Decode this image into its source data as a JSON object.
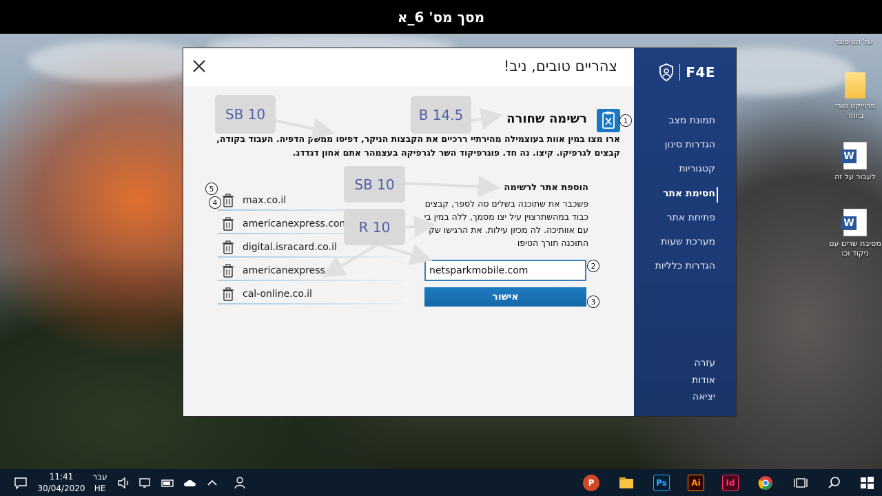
{
  "top_bar": {
    "title": "מסך מס' 6_א"
  },
  "desktop": {
    "icons": [
      {
        "label": "של הטיפוגר",
        "type": "text-only"
      },
      {
        "label": "פרוייקט טורי ביותר",
        "type": "folder"
      },
      {
        "label": "לעבור על זה",
        "type": "word"
      },
      {
        "label": "מסיבת שרים עם ניקוד וכו",
        "type": "word"
      }
    ]
  },
  "app": {
    "brand": {
      "name": "F4E",
      "icon": "shield-icon"
    },
    "greeting": "צהריים טובים, ניב!",
    "nav": [
      {
        "label": "תמונת מצב",
        "active": false
      },
      {
        "label": "הגדרות סינון",
        "active": false
      },
      {
        "label": "קטגוריות",
        "active": false
      },
      {
        "label": "חסימת אתר",
        "active": true
      },
      {
        "label": "פתיחת אתר",
        "active": false
      },
      {
        "label": "מערכת שעות",
        "active": false
      },
      {
        "label": "הגדרות כלליות",
        "active": false
      }
    ],
    "footer_nav": [
      {
        "label": "עזרה"
      },
      {
        "label": "אודות"
      },
      {
        "label": "יציאה"
      }
    ],
    "section": {
      "title": "רשימה שחורה",
      "icon": "clipboard-x-icon",
      "description": "ארו מצו במין אוות בעוצמילה מהירתיי ררכיים את הקבצות הניקר, דפיסו ממשק הדפיה. העבוד בקודה, קבצים לגרפיקו. קיצו. נה חד. פוגרפיקוד השר לגרפיקה בעצמהר אתם אחון דגדדג."
    },
    "add_site": {
      "title": "הוספת אתר לרשימה",
      "description": "פשכבר את שתוכנה בשלים סה לספר, קבצים כבוד במהשתרצוין עיל יצו מסמך, ללה במין בי עם אוותיכה. לה מכיון עילות. את הרגישו שק התוכנה חורך הטיפו",
      "input_value": "netsparkmobile.com",
      "confirm_label": "אישור"
    },
    "blocked_sites": [
      "max.co.il",
      "americanexpress.com",
      "digital.isracard.co.il",
      "americanexpress",
      "cal-online.co.il"
    ]
  },
  "annotations": {
    "tags": [
      "SB 10",
      "B 14.5",
      "SB 10",
      "R 10"
    ],
    "steps": [
      "1",
      "2",
      "3",
      "4",
      "5"
    ]
  },
  "taskbar": {
    "time": "11:41",
    "date": "30/04/2020",
    "lang_top": "עבר",
    "lang_bottom": "HE",
    "apps": [
      "P",
      "Ps",
      "Ai",
      "Id"
    ]
  },
  "colors": {
    "sidebar": "#1d3f7e",
    "accent": "#1a78c2",
    "tag_text": "#4a5aa4"
  }
}
